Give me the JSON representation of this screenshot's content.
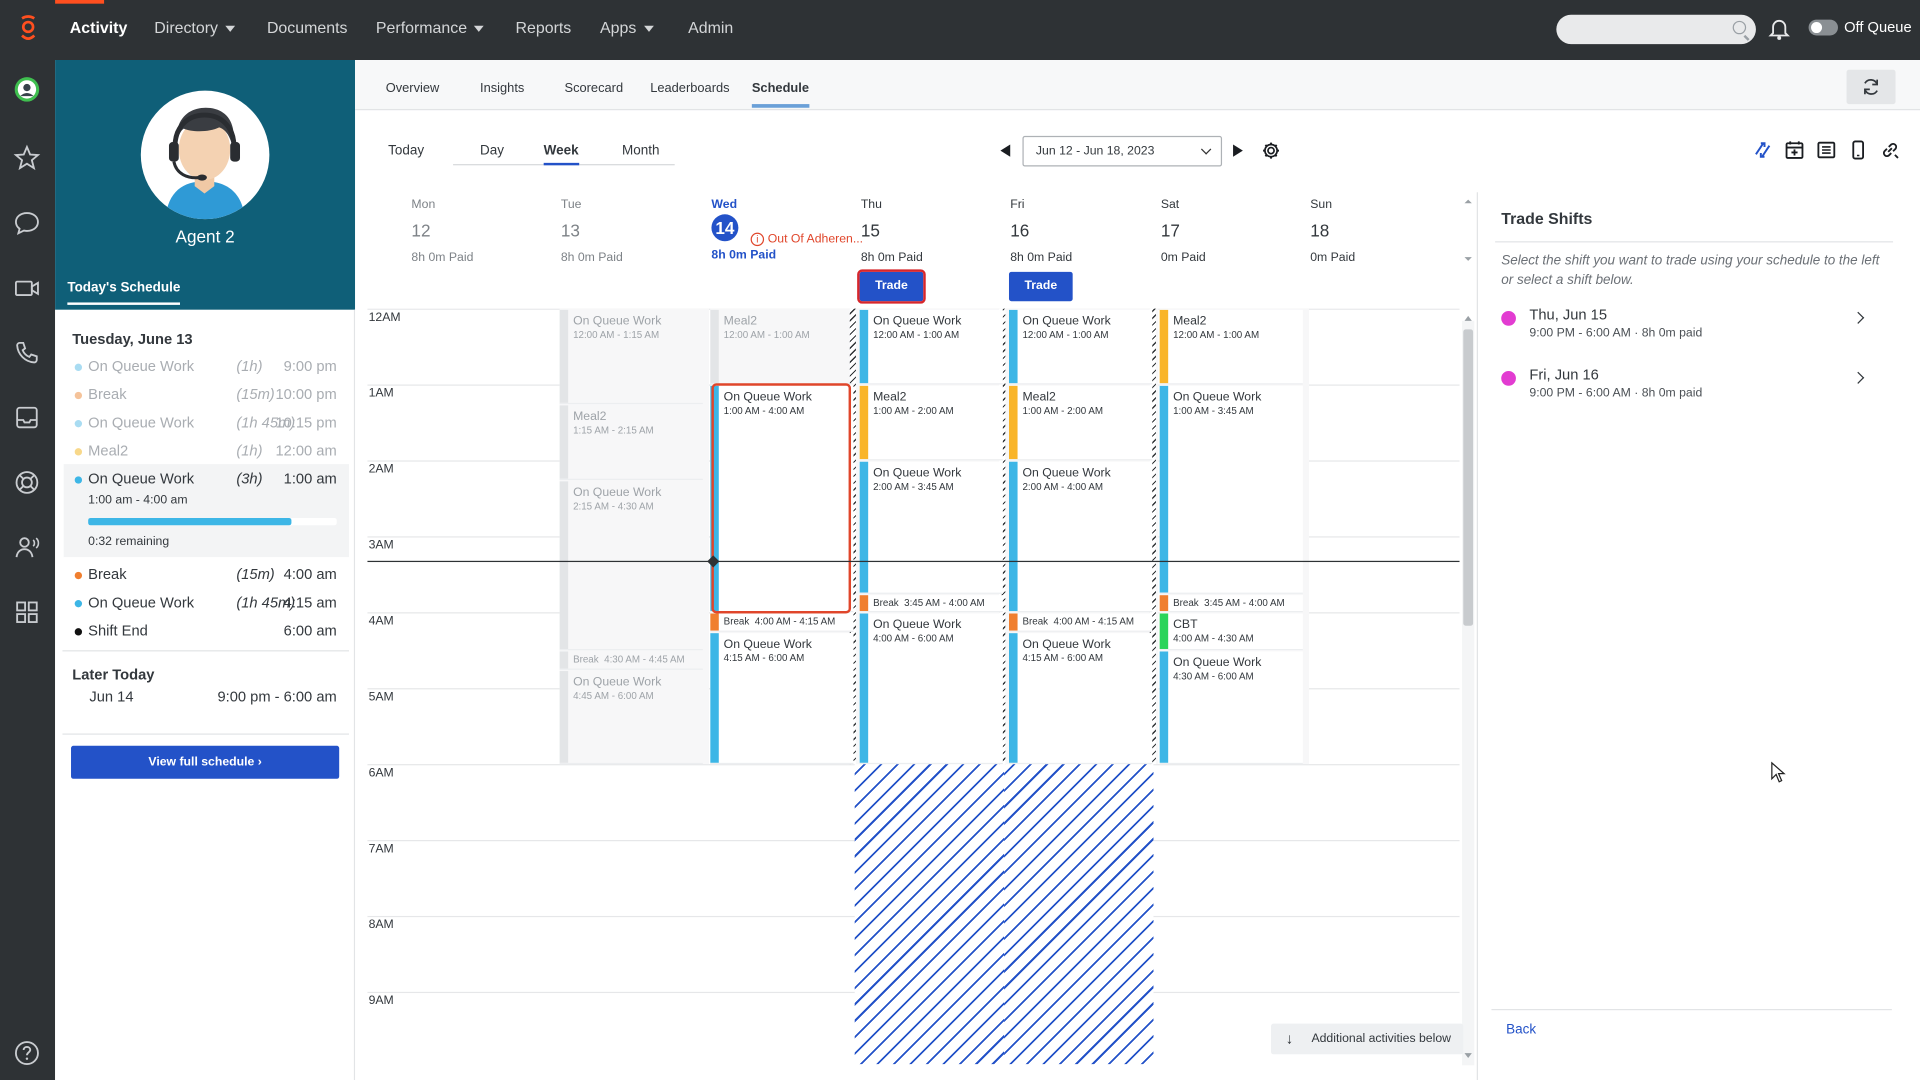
{
  "topnav": {
    "items": [
      "Activity",
      "Directory",
      "Documents",
      "Performance",
      "Reports",
      "Apps",
      "Admin"
    ],
    "active": "Activity",
    "search_placeholder": "",
    "queue_status": "Off Queue"
  },
  "rail_icons": [
    "genesys-logo",
    "status-avatar-icon",
    "favorites-star-icon",
    "chat-bubble-icon",
    "video-icon",
    "phone-icon",
    "inbox-icon",
    "support-icon",
    "contacts-icon",
    "apps-grid-icon",
    "help-icon"
  ],
  "profile": {
    "name": "Agent 2",
    "todays_schedule_tab": "Today's Schedule"
  },
  "todays_schedule": {
    "date_heading": "Tuesday, June 13",
    "items": [
      {
        "name": "On Queue Work",
        "duration": "(1h)",
        "time": "9:00 pm",
        "color": "#a9dcf2",
        "state": "past"
      },
      {
        "name": "Break",
        "duration": "(15m)",
        "time": "10:00 pm",
        "color": "#f5c39a",
        "state": "past"
      },
      {
        "name": "On Queue Work",
        "duration": "(1h 45m)",
        "time": "10:15 pm",
        "color": "#a9dcf2",
        "state": "past"
      },
      {
        "name": "Meal2",
        "duration": "(1h)",
        "time": "12:00 am",
        "color": "#f8d88a",
        "state": "past"
      },
      {
        "name": "On Queue Work",
        "duration": "(3h)",
        "time": "1:00 am",
        "color": "#3db6e6",
        "state": "current"
      },
      {
        "name": "Break",
        "duration": "(15m)",
        "time": "4:00 am",
        "color": "#f07f2f",
        "state": "future"
      },
      {
        "name": "On Queue Work",
        "duration": "(1h 45m)",
        "time": "4:15 am",
        "color": "#3db6e6",
        "state": "future"
      },
      {
        "name": "Shift End",
        "duration": "",
        "time": "6:00 am",
        "color": "#111111",
        "state": "future"
      }
    ],
    "current_range": "1:00 am - 4:00 am",
    "current_progress": 0.82,
    "remaining": "0:32 remaining",
    "later_heading": "Later Today",
    "later_date": "Jun 14",
    "later_time": "9:00 pm - 6:00 am",
    "view_full_button": "View full schedule ›"
  },
  "subnav": {
    "tabs": [
      "Overview",
      "Insights",
      "Scorecard",
      "Leaderboards",
      "Schedule"
    ],
    "active": "Schedule"
  },
  "toolbar": {
    "today": "Today",
    "range_tabs": [
      "Day",
      "Week",
      "Month"
    ],
    "active_range": "Week",
    "date_range": "Jun 12 - Jun 18, 2023",
    "tool_icons": [
      "trade-shift-icon",
      "add-calendar-icon",
      "list-view-icon",
      "mobile-icon",
      "link-icon"
    ]
  },
  "days": [
    {
      "dow": "Mon",
      "num": "12",
      "paid": "8h 0m Paid",
      "style": "past"
    },
    {
      "dow": "Tue",
      "num": "13",
      "paid": "8h 0m Paid",
      "style": "past"
    },
    {
      "dow": "Wed",
      "num": "14",
      "paid": "8h 0m Paid",
      "style": "today",
      "alert": "Out Of Adheren..."
    },
    {
      "dow": "Thu",
      "num": "15",
      "paid": "8h 0m Paid",
      "style": "dark",
      "trade": "Trade",
      "trade_selected": true
    },
    {
      "dow": "Fri",
      "num": "16",
      "paid": "8h 0m Paid",
      "style": "dark",
      "trade": "Trade",
      "trade_selected": false
    },
    {
      "dow": "Sat",
      "num": "17",
      "paid": "0m Paid",
      "style": "dark"
    },
    {
      "dow": "Sun",
      "num": "18",
      "paid": "0m Paid",
      "style": "dark"
    }
  ],
  "hour_labels": [
    "12AM",
    "1AM",
    "2AM",
    "3AM",
    "4AM",
    "5AM",
    "6AM",
    "7AM",
    "8AM",
    "9AM"
  ],
  "activities": [
    {
      "day": 1,
      "name": "On Queue Work",
      "time": "12:00 AM - 1:15 AM",
      "start": 0,
      "end": 1.25,
      "color": "#3db6e6",
      "past": true
    },
    {
      "day": 1,
      "name": "Meal2",
      "time": "1:15 AM - 2:15 AM",
      "start": 1.25,
      "end": 2.25,
      "color": "#f9b52a",
      "past": true
    },
    {
      "day": 1,
      "name": "On Queue Work",
      "time": "2:15 AM - 4:30 AM",
      "start": 2.25,
      "end": 4.5,
      "color": "#3db6e6",
      "past": true
    },
    {
      "day": 1,
      "name": "Break",
      "time": "4:30 AM - 4:45 AM",
      "start": 4.5,
      "end": 4.75,
      "color": "#f07f2f",
      "past": true,
      "small": true
    },
    {
      "day": 1,
      "name": "On Queue Work",
      "time": "4:45 AM - 6:00 AM",
      "start": 4.75,
      "end": 6,
      "color": "#3db6e6",
      "past": true
    },
    {
      "day": 2,
      "name": "Meal2",
      "time": "12:00 AM - 1:00 AM",
      "start": 0,
      "end": 1,
      "color": "#f9b52a",
      "past": true
    },
    {
      "day": 2,
      "name": "On Queue Work",
      "time": "1:00 AM - 4:00 AM",
      "start": 1,
      "end": 4,
      "color": "#3db6e6",
      "selected": true
    },
    {
      "day": 2,
      "name": "Break",
      "time": "4:00 AM - 4:15 AM",
      "start": 4,
      "end": 4.25,
      "color": "#f07f2f",
      "small": true
    },
    {
      "day": 2,
      "name": "On Queue Work",
      "time": "4:15 AM - 6:00 AM",
      "start": 4.25,
      "end": 6,
      "color": "#3db6e6"
    },
    {
      "day": 3,
      "name": "On Queue Work",
      "time": "12:00 AM - 1:00 AM",
      "start": 0,
      "end": 1,
      "color": "#3db6e6"
    },
    {
      "day": 3,
      "name": "Meal2",
      "time": "1:00 AM - 2:00 AM",
      "start": 1,
      "end": 2,
      "color": "#f9b52a"
    },
    {
      "day": 3,
      "name": "On Queue Work",
      "time": "2:00 AM - 3:45 AM",
      "start": 2,
      "end": 3.75,
      "color": "#3db6e6"
    },
    {
      "day": 3,
      "name": "Break",
      "time": "3:45 AM - 4:00 AM",
      "start": 3.75,
      "end": 4,
      "color": "#f07f2f",
      "small": true
    },
    {
      "day": 3,
      "name": "On Queue Work",
      "time": "4:00 AM - 6:00 AM",
      "start": 4,
      "end": 6,
      "color": "#3db6e6"
    },
    {
      "day": 4,
      "name": "On Queue Work",
      "time": "12:00 AM - 1:00 AM",
      "start": 0,
      "end": 1,
      "color": "#3db6e6"
    },
    {
      "day": 4,
      "name": "Meal2",
      "time": "1:00 AM - 2:00 AM",
      "start": 1,
      "end": 2,
      "color": "#f9b52a"
    },
    {
      "day": 4,
      "name": "On Queue Work",
      "time": "2:00 AM - 4:00 AM",
      "start": 2,
      "end": 4,
      "color": "#3db6e6"
    },
    {
      "day": 4,
      "name": "Break",
      "time": "4:00 AM - 4:15 AM",
      "start": 4,
      "end": 4.25,
      "color": "#f07f2f",
      "small": true
    },
    {
      "day": 4,
      "name": "On Queue Work",
      "time": "4:15 AM - 6:00 AM",
      "start": 4.25,
      "end": 6,
      "color": "#3db6e6"
    },
    {
      "day": 5,
      "name": "Meal2",
      "time": "12:00 AM - 1:00 AM",
      "start": 0,
      "end": 1,
      "color": "#f9b52a"
    },
    {
      "day": 5,
      "name": "On Queue Work",
      "time": "1:00 AM - 3:45 AM",
      "start": 1,
      "end": 3.75,
      "color": "#3db6e6"
    },
    {
      "day": 5,
      "name": "Break",
      "time": "3:45 AM - 4:00 AM",
      "start": 3.75,
      "end": 4,
      "color": "#f07f2f",
      "small": true
    },
    {
      "day": 5,
      "name": "CBT",
      "time": "4:00 AM - 4:30 AM",
      "start": 4,
      "end": 4.5,
      "color": "#2bd45a"
    },
    {
      "day": 5,
      "name": "On Queue Work",
      "time": "4:30 AM - 6:00 AM",
      "start": 4.5,
      "end": 6,
      "color": "#3db6e6"
    }
  ],
  "additional_below": "Additional activities below",
  "trade_panel": {
    "title": "Trade Shifts",
    "instructions": "Select the shift you want to trade using your schedule to the left or select a shift below.",
    "shifts": [
      {
        "date": "Thu, Jun 15",
        "time": "9:00 PM - 6:00 AM · 8h 0m paid"
      },
      {
        "date": "Fri, Jun 16",
        "time": "9:00 PM - 6:00 AM · 8h 0m paid"
      }
    ],
    "back": "Back"
  }
}
